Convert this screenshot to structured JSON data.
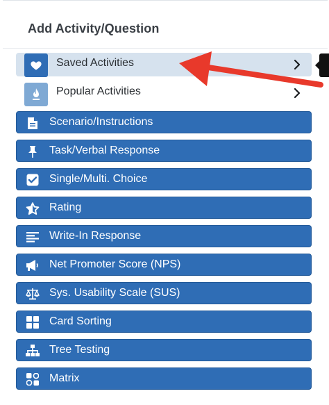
{
  "panel": {
    "title": "Add Activity/Question"
  },
  "categories": [
    {
      "label": "Saved Activities",
      "icon": "heart-icon",
      "selected": true
    },
    {
      "label": "Popular Activities",
      "icon": "flame-icon",
      "selected": false
    }
  ],
  "activities": [
    {
      "label": "Scenario/Instructions",
      "icon": "document-icon"
    },
    {
      "label": "Task/Verbal Response",
      "icon": "pin-icon"
    },
    {
      "label": "Single/Multi. Choice",
      "icon": "checkbox-icon"
    },
    {
      "label": "Rating",
      "icon": "star-icon"
    },
    {
      "label": "Write-In Response",
      "icon": "text-lines-icon"
    },
    {
      "label": "Net Promoter Score (NPS)",
      "icon": "megaphone-icon"
    },
    {
      "label": "Sys. Usability Scale (SUS)",
      "icon": "scale-icon"
    },
    {
      "label": "Card Sorting",
      "icon": "grid-icon"
    },
    {
      "label": "Tree Testing",
      "icon": "sitemap-icon"
    },
    {
      "label": "Matrix",
      "icon": "matrix-icon"
    }
  ],
  "colors": {
    "accent": "#2f6db5",
    "selected_row": "#d6e2ee",
    "annotation_arrow": "#e8392b"
  }
}
